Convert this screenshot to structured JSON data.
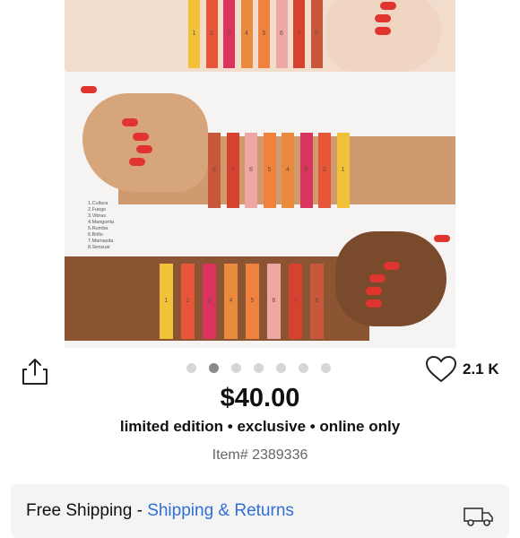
{
  "product_image": {
    "legend": [
      "1.Cultura",
      "2.Fuego",
      "3.Vibras",
      "4.Mangorita",
      "5.Rumba",
      "6.Brillo",
      "7.Mamasita",
      "8.Sensual"
    ],
    "swatch_numbers": [
      "1",
      "2",
      "3",
      "4",
      "5",
      "6",
      "7",
      "8"
    ],
    "swatch_colors": [
      "#f2c13a",
      "#e8563a",
      "#d9335e",
      "#e98a3c",
      "#f0823e",
      "#eea7a3",
      "#d7412f",
      "#c9573a"
    ]
  },
  "carousel": {
    "count": 7,
    "active_index": 1
  },
  "likes": {
    "count_label": "2.1 K"
  },
  "price": "$40.00",
  "tags": "limited edition • exclusive • online only",
  "item_number": "Item# 2389336",
  "shipping": {
    "prefix": "Free Shipping - ",
    "link_label": "Shipping & Returns"
  },
  "icons": {
    "share": "share-icon",
    "like": "heart-icon",
    "truck": "truck-icon"
  }
}
